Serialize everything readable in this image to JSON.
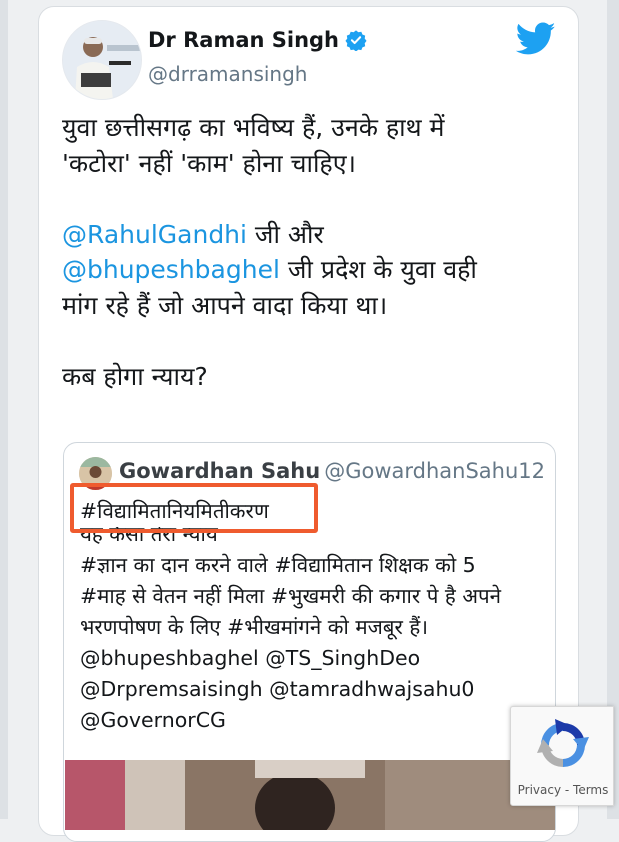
{
  "tweet": {
    "author_name": "Dr Raman Singh",
    "author_handle": "@drramansingh",
    "lines": [
      {
        "text": "युवा छत्तीसगढ़ का भविष्य हैं, उनके हाथ में",
        "mention": "",
        "after": ""
      },
      {
        "text": "'कटोरा' नहीं 'काम' होना चाहिए।",
        "mention": "",
        "after": ""
      },
      {
        "text": "",
        "mention": "",
        "after": ""
      },
      {
        "text": "",
        "mention": "@RahulGandhi",
        "after": " जी और"
      },
      {
        "text": "",
        "mention": "@bhupeshbaghel",
        "after": "  जी प्रदेश के युवा वही"
      },
      {
        "text": "मांग रहे हैं जो आपने वादा किया था।",
        "mention": "",
        "after": ""
      },
      {
        "text": "",
        "mention": "",
        "after": ""
      },
      {
        "text": "कब होगा न्याय?",
        "mention": "",
        "after": ""
      }
    ]
  },
  "quoted_tweet": {
    "author_name": "Gowardhan Sahu",
    "author_handle": "@GowardhanSahu12",
    "lines": [
      "#विद्यामितानियमितीकरण",
      "यह कैसा तेरा न्याय",
      "#ज्ञान का दान करने वाले #विद्यामितान शिक्षक को 5",
      "#माह से वेतन नहीं मिला #भुखमरी की कगार पे है अपने",
      "भरणपोषण के लिए #भीखमांगने को मजबूर हैं।",
      "@bhupeshbaghel @TS_SinghDeo",
      "@Drpremsaisingh @tamradhwajsahu0",
      "@GovernorCG"
    ]
  },
  "recaptcha": {
    "privacy": "Privacy",
    "separator": " - ",
    "terms": "Terms"
  },
  "icons": {
    "verified": "verified-badge-icon",
    "brand": "twitter-bird-icon",
    "captcha": "recaptcha-icon"
  },
  "colors": {
    "mention": "#1b95e0",
    "twitter_blue": "#1da1f2",
    "highlight": "#ef5b2e"
  }
}
